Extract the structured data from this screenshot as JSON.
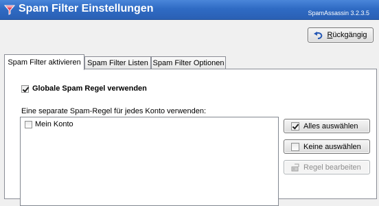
{
  "window": {
    "title": "Spam Filter Einstellungen",
    "version": "SpamAssassin 3.2.3.5"
  },
  "toolbar": {
    "undo_label": "Rückgängig"
  },
  "tabs": [
    {
      "label": "Spam Filter aktivieren",
      "active": true
    },
    {
      "label": "Spam Filter Listen",
      "active": false
    },
    {
      "label": "Spam Filter Optionen",
      "active": false
    }
  ],
  "panel": {
    "global_rule": {
      "label": "Globale Spam Regel verwenden",
      "checked": true
    },
    "separate_label": "Eine separate Spam-Regel für jedes Konto verwenden:",
    "accounts": [
      {
        "label": "Mein Konto",
        "checked": false
      }
    ],
    "buttons": {
      "select_all": "Alles auswählen",
      "select_none": "Keine auswählen",
      "edit_rule": "Regel bearbeiten"
    }
  },
  "colors": {
    "titlebar": "#2f6bc4",
    "tab_border": "#898c95"
  }
}
